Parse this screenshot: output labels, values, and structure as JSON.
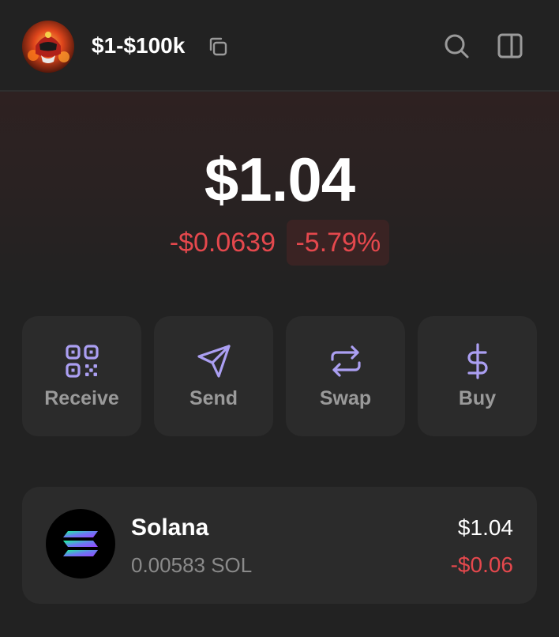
{
  "header": {
    "account_name": "$1-$100k",
    "avatar_icon": "helmet-avatar-icon",
    "copy_icon": "copy-icon",
    "search_icon": "search-icon",
    "sidepanel_icon": "sidepanel-icon"
  },
  "balance": {
    "total": "$1.04",
    "change_abs": "-$0.0639",
    "change_pct": "-5.79%"
  },
  "actions": [
    {
      "label": "Receive",
      "icon": "qr-code-icon"
    },
    {
      "label": "Send",
      "icon": "send-icon"
    },
    {
      "label": "Swap",
      "icon": "swap-icon"
    },
    {
      "label": "Buy",
      "icon": "dollar-icon"
    }
  ],
  "tokens": [
    {
      "name": "Solana",
      "amount": "0.00583 SOL",
      "value": "$1.04",
      "change": "-$0.06",
      "icon": "solana-logo-icon"
    }
  ],
  "colors": {
    "background": "#222222",
    "card": "#2b2b2b",
    "accent": "#ab9ff2",
    "negative": "#e5484d",
    "muted": "#9a9a9a"
  }
}
